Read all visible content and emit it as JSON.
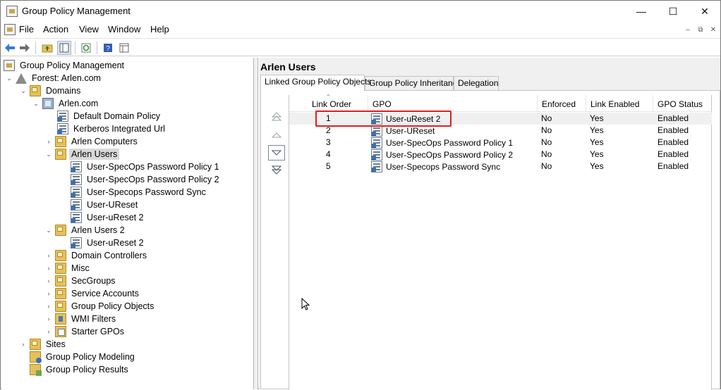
{
  "window": {
    "title": "Group Policy Management",
    "controls": {
      "minimize": "—",
      "maximize": "☐",
      "close": "✕"
    }
  },
  "menu": {
    "items": [
      "File",
      "Action",
      "View",
      "Window",
      "Help"
    ],
    "mdi_controls": [
      "–",
      "⧉",
      "✕"
    ]
  },
  "toolbar": {
    "buttons": [
      "back-arrow-icon",
      "forward-arrow-icon",
      "up-folder-icon",
      "show-hide-tree-icon",
      "refresh-icon",
      "help-icon",
      "properties-icon"
    ]
  },
  "tree": {
    "root": "Group Policy Management",
    "forest": "Forest: Arlen.com",
    "domains": "Domains",
    "domain": "Arlen.com",
    "default_domain_policy": "Default Domain Policy",
    "kerberos": "Kerberos Integrated Url",
    "arlen_computers": "Arlen Computers",
    "arlen_users": "Arlen Users",
    "arlen_users_children": [
      "User-SpecOps Password Policy 1",
      "User-SpecOps Password Policy 2",
      "User-Specops Password Sync",
      "User-UReset",
      "User-uReset 2"
    ],
    "arlen_users_2": "Arlen Users 2",
    "arlen_users_2_children": [
      "User-uReset 2"
    ],
    "domain_controllers": "Domain Controllers",
    "misc": "Misc",
    "secgroups": "SecGroups",
    "service_accounts": "Service Accounts",
    "group_policy_objects": "Group Policy Objects",
    "wmi_filters": "WMI Filters",
    "starter_gpos": "Starter GPOs",
    "sites": "Sites",
    "modeling": "Group Policy Modeling",
    "results": "Group Policy Results"
  },
  "details": {
    "title": "Arlen Users",
    "tabs": [
      "Linked Group Policy Objects",
      "Group Policy Inheritance",
      "Delegation"
    ],
    "active_tab": "Linked Group Policy Objects",
    "columns": [
      "Link Order",
      "GPO",
      "Enforced",
      "Link Enabled",
      "GPO Status"
    ],
    "rows": [
      {
        "order": "1",
        "gpo": "User-uReset 2",
        "enforced": "No",
        "link_enabled": "Yes",
        "status": "Enabled"
      },
      {
        "order": "2",
        "gpo": "User-UReset",
        "enforced": "No",
        "link_enabled": "Yes",
        "status": "Enabled"
      },
      {
        "order": "3",
        "gpo": "User-SpecOps Password Policy 1",
        "enforced": "No",
        "link_enabled": "Yes",
        "status": "Enabled"
      },
      {
        "order": "4",
        "gpo": "User-SpecOps Password Policy 2",
        "enforced": "No",
        "link_enabled": "Yes",
        "status": "Enabled"
      },
      {
        "order": "5",
        "gpo": "User-Specops Password Sync",
        "enforced": "No",
        "link_enabled": "Yes",
        "status": "Enabled"
      }
    ],
    "order_buttons": [
      "move-to-top-icon",
      "move-up-icon",
      "move-down-icon",
      "move-to-bottom-icon"
    ]
  },
  "colors": {
    "highlight": "#e21c1c",
    "selection": "#d9d9d9",
    "link_blue": "#3b6fb6"
  }
}
